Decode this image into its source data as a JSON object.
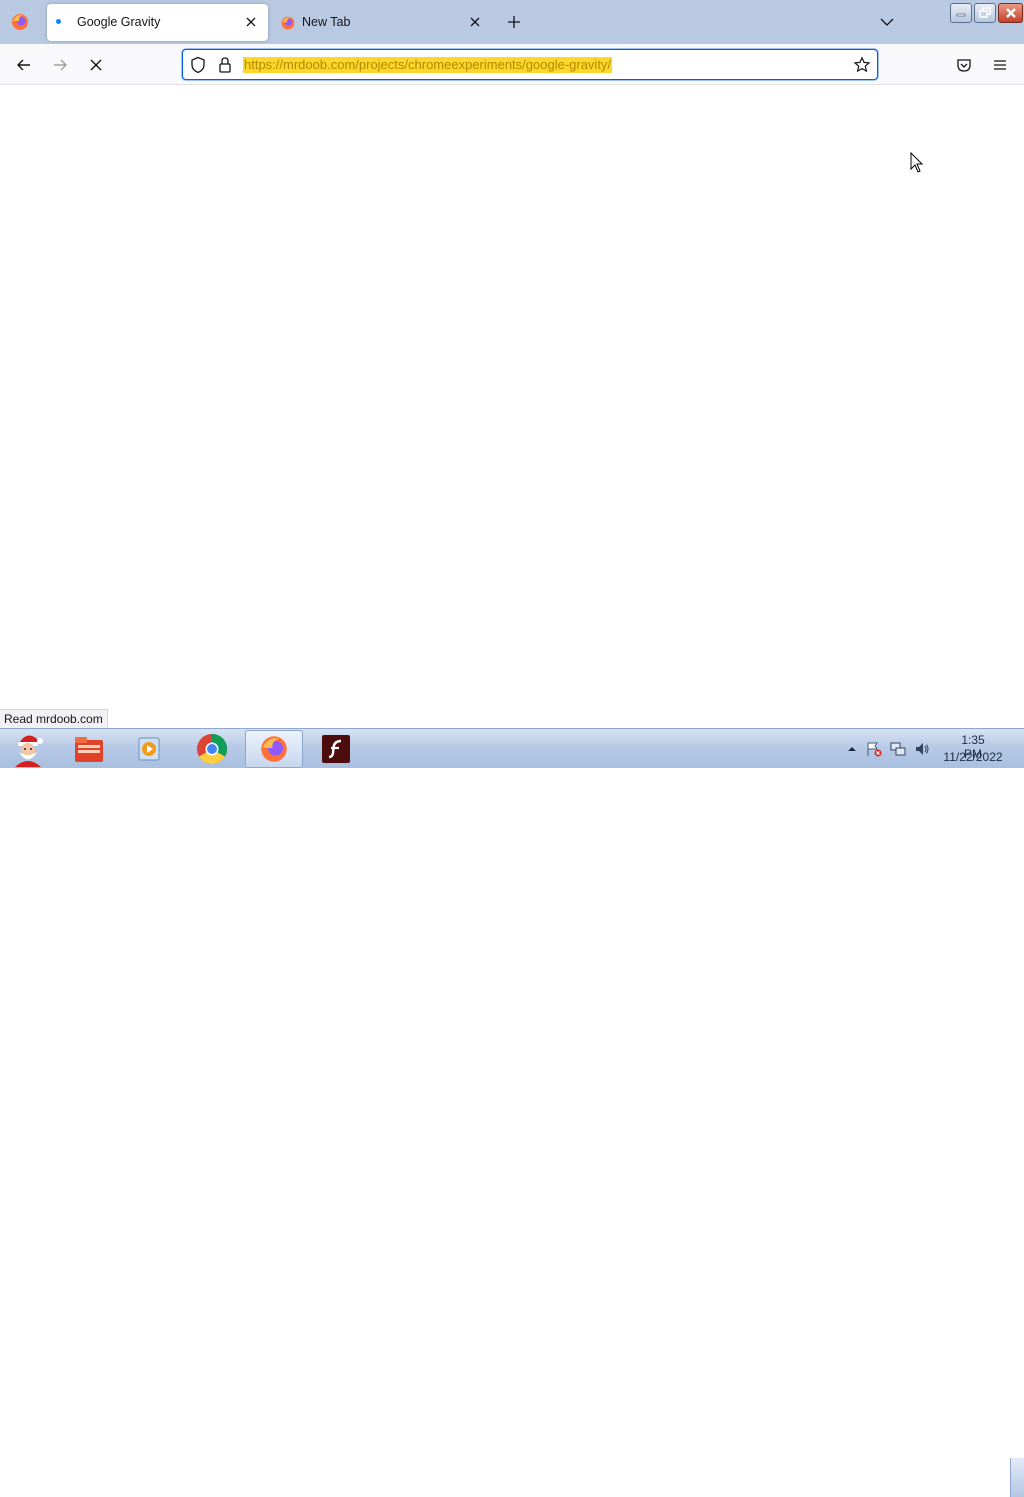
{
  "browser": {
    "tabs": [
      {
        "title": "Google Gravity",
        "active": true,
        "loading": true
      },
      {
        "title": "New Tab",
        "active": false
      }
    ],
    "url": "https://mrdoob.com/projects/chromeexperiments/google-gravity/",
    "status": "Read mrdoob.com"
  },
  "taskbar": {
    "apps": [
      "start-santa",
      "file-manager",
      "media-player",
      "chrome",
      "firefox",
      "flash"
    ],
    "active_app": "firefox",
    "clock": {
      "time": "1:35 PM",
      "date": "11/22/2022"
    }
  },
  "colors": {
    "tabstrip": "#b9c9e1",
    "urlbar_focus": "#0060df",
    "url_highlight": "#ffd62a",
    "taskbar": "#b7cae6"
  }
}
